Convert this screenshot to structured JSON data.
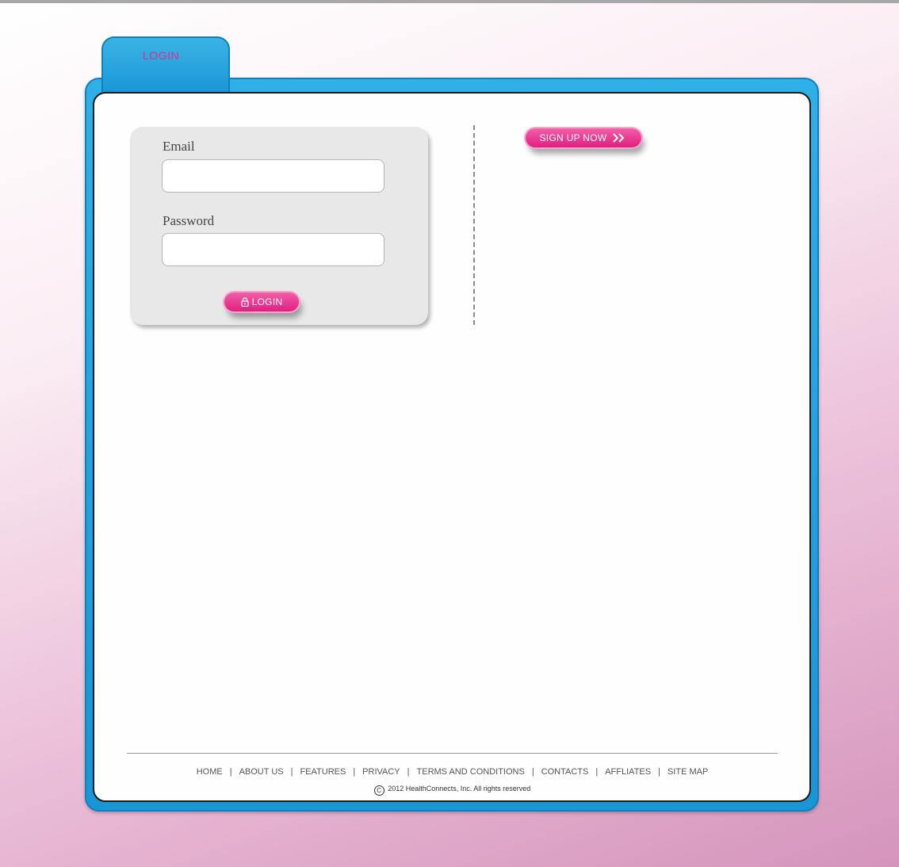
{
  "tab": {
    "label": "LOGIN"
  },
  "login": {
    "email_label": "Email",
    "email_value": "",
    "password_label": "Password",
    "password_value": "",
    "login_button": "LOGIN"
  },
  "signup": {
    "button_label": "SIGN UP NOW"
  },
  "footer": {
    "links": [
      "HOME",
      "ABOUT US",
      "FEATURES",
      "PRIVACY",
      "TERMS AND CONDITIONS",
      "CONTACTS",
      "AFFLIATES",
      "SITE MAP"
    ],
    "copyright": "2012 HealthConnects, Inc.  All rights reserved",
    "copyright_symbol": "C"
  },
  "colors": {
    "accent_pink": "#e8288a",
    "folder_blue": "#1a98d6"
  },
  "icons": {
    "login_button": "lock-icon",
    "signup_button": "double-chevron-right-icon",
    "copyright": "copyright-icon"
  }
}
